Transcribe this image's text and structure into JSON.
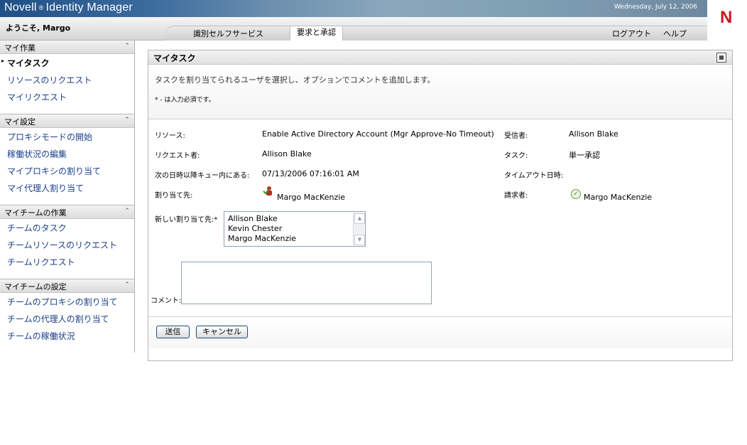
{
  "header": {
    "brand": "Novell",
    "reg_mark": "®",
    "product": "Identity Manager",
    "date": "Wednesday, July 12, 2006",
    "logo_letter": "N",
    "welcome": "ようこそ, Margo",
    "tabs": [
      {
        "label": "識別セルフサービス",
        "active": false
      },
      {
        "label": "要求と承認",
        "active": true
      }
    ],
    "logout": "ログアウト",
    "help": "ヘルプ"
  },
  "sidebar": {
    "sections": [
      {
        "title": "マイ作業",
        "items": [
          {
            "label": "マイタスク",
            "active": true
          },
          {
            "label": "リソースのリクエスト"
          },
          {
            "label": "マイリクエスト"
          }
        ]
      },
      {
        "title": "マイ設定",
        "items": [
          {
            "label": "プロキシモードの開始"
          },
          {
            "label": "稼働状況の編集"
          },
          {
            "label": "マイプロキシの割り当て"
          },
          {
            "label": "マイ代理人割り当て"
          }
        ]
      },
      {
        "title": "マイチームの作業",
        "items": [
          {
            "label": "チームのタスク"
          },
          {
            "label": "チームリソースのリクエスト"
          },
          {
            "label": "チームリクエスト"
          }
        ]
      },
      {
        "title": "マイチームの設定",
        "items": [
          {
            "label": "チームのプロキシの割り当て"
          },
          {
            "label": "チームの代理人の割り当て"
          },
          {
            "label": "チームの稼働状況"
          }
        ]
      }
    ]
  },
  "panel": {
    "title": "マイタスク",
    "instructions": "タスクを割り当てられるユーザを選択し、オプションでコメントを追加します。",
    "required_note": "* - は入力必須です。",
    "fields": {
      "resource_label": "リソース:",
      "resource_value": "Enable Active Directory Account (Mgr Approve-No Timeout)",
      "recipient_label": "受信者:",
      "recipient_value": "Allison Blake",
      "requester_label": "リクエスト者:",
      "requester_value": "Allison Blake",
      "task_label": "タスク:",
      "task_value": "単一承認",
      "queued_label": "次の日時以降キュー内にある:",
      "queued_value": "07/13/2006 07:16:01 AM",
      "timeout_label": "タイムアウト日時:",
      "assigned_label": "割り当て先:",
      "assigned_value": "Margo MacKenzie",
      "claimant_label": "請求者:",
      "claimant_value": "Margo MacKenzie",
      "new_assign_label": "新しい割り当て先:*",
      "comment_label": "コメント:"
    },
    "assignees": [
      "Allison Blake",
      "Kevin Chester",
      "Margo MacKenzie"
    ],
    "submit": "送信",
    "cancel": "キャンセル"
  }
}
